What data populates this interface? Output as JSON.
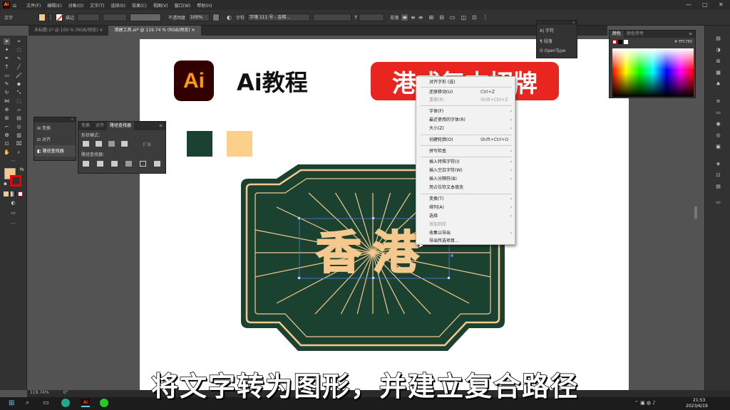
{
  "menubar": {
    "logo": "Ai",
    "items": [
      "文件(F)",
      "编辑(E)",
      "对象(O)",
      "文字(T)",
      "选择(S)",
      "效果(C)",
      "视图(V)",
      "窗口(W)",
      "帮助(H)"
    ]
  },
  "ctrlbar": {
    "mode_label": "文字",
    "stroke_label": "描边",
    "opacity_label": "不透明度",
    "opacity_value": "100%",
    "char_label": "字符",
    "font_value": "字魂 111 号 - 金梯…",
    "para_label": "段落"
  },
  "tabs": [
    {
      "label": "未标题-1* @ 100 % (RGB/预览)"
    },
    {
      "label": "港建工具.ai* @ 119.74 % (RGB/预览)"
    }
  ],
  "artwork": {
    "ai_badge": "Ai",
    "heading": "Ai教程",
    "banner": "港式复古招牌",
    "sign_text": "香港",
    "swatch_colors": [
      "#1b4230",
      "#fbd08a"
    ]
  },
  "colors": {
    "sign_green": "#1b4230",
    "sign_cream": "#f5c98e",
    "banner_red": "#e8251f",
    "ai_orange": "#ff9a00",
    "ai_bg": "#330000"
  },
  "transform_panel": {
    "items": [
      "变换",
      "对齐",
      "路径查找器"
    ]
  },
  "pathfinder_panel": {
    "tabs": [
      "变换",
      "对齐",
      "路径查找器"
    ],
    "shape_modes_label": "形状模式：",
    "expand_label": "扩展",
    "pathfinders_label": "路径查找器："
  },
  "char_popup": {
    "items": [
      "字符",
      "段落",
      "OpenType"
    ]
  },
  "color_panel": {
    "tabs": [
      "颜色",
      "颜色参考"
    ],
    "hex": "FFC783"
  },
  "context_menu": {
    "items": [
      {
        "label": "对齐字形 (选)",
        "shortcut": "",
        "arrow": "",
        "disabled": false
      },
      {
        "label": "还原移动(U)",
        "shortcut": "Ctrl+Z",
        "arrow": "",
        "disabled": false
      },
      {
        "label": "重做(R)",
        "shortcut": "Shift+Ctrl+Z",
        "arrow": "",
        "disabled": true
      },
      {
        "label": "字体(F)",
        "shortcut": "",
        "arrow": "›",
        "disabled": false
      },
      {
        "label": "最近使用的字体(R)",
        "shortcut": "",
        "arrow": "›",
        "disabled": false
      },
      {
        "label": "大小(Z)",
        "shortcut": "",
        "arrow": "›",
        "disabled": false
      },
      {
        "label": "创建轮廓(O)",
        "shortcut": "Shift+Ctrl+O",
        "arrow": "",
        "disabled": false
      },
      {
        "label": "拼写检查",
        "shortcut": "",
        "arrow": "›",
        "disabled": false
      },
      {
        "label": "插入特殊字符(I)",
        "shortcut": "",
        "arrow": "›",
        "disabled": false
      },
      {
        "label": "插入空白字符(W)",
        "shortcut": "",
        "arrow": "›",
        "disabled": false
      },
      {
        "label": "插入分隔符(B)",
        "shortcut": "",
        "arrow": "›",
        "disabled": false
      },
      {
        "label": "用占位符文本填充",
        "shortcut": "",
        "arrow": "",
        "disabled": false
      },
      {
        "label": "变换(T)",
        "shortcut": "",
        "arrow": "›",
        "disabled": false
      },
      {
        "label": "排列(A)",
        "shortcut": "",
        "arrow": "›",
        "disabled": false
      },
      {
        "label": "选择",
        "shortcut": "",
        "arrow": "›",
        "disabled": false
      },
      {
        "label": "添加到库",
        "shortcut": "",
        "arrow": "",
        "disabled": true
      },
      {
        "label": "收集以导出",
        "shortcut": "",
        "arrow": "›",
        "disabled": false
      },
      {
        "label": "导出所选项目...",
        "shortcut": "",
        "arrow": "",
        "disabled": false
      }
    ]
  },
  "status": {
    "zoom": "119.74%",
    "angle": "0°"
  },
  "taskbar": {
    "time": "21:53",
    "date": "2023/6/19"
  },
  "subtitle": "将文字转为图形，并建立复合路径"
}
